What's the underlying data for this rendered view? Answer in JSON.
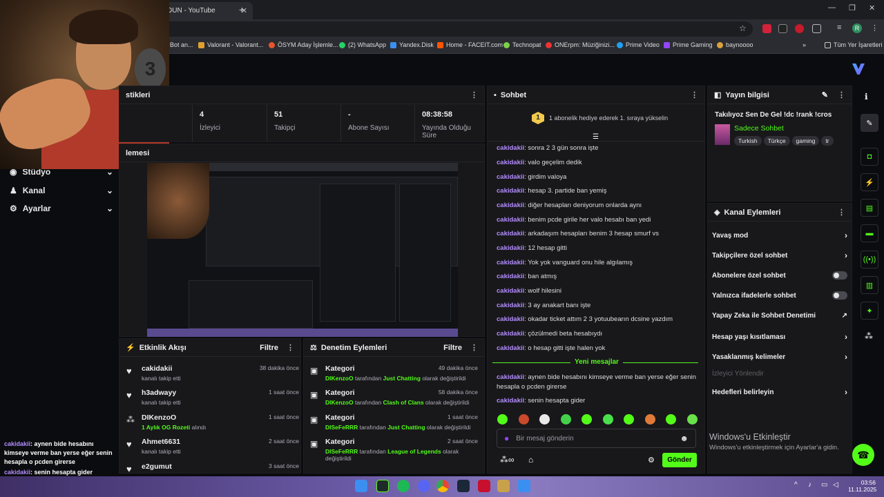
{
  "browser": {
    "tab_title": "DUN - YouTube",
    "bookmarks": [
      "Bot an...",
      "Valorant - Valorant...",
      "ÖSYM Aday İşlemle...",
      "(2) WhatsApp",
      "Yandex.Disk",
      "Home - FACEIT.com",
      "Technopat",
      "ONErpm: Müziğinizi...",
      "Prime Video",
      "Prime Gaming",
      "baynoooo"
    ],
    "all_bookmarks": "Tüm Yer İşaretleri",
    "profile_initial": "R"
  },
  "sidebar": {
    "items": [
      "Stüdyo",
      "Kanal",
      "Ayarlar"
    ]
  },
  "overlay_chat": [
    {
      "user": "cakidakii",
      "msg": "aynen bide hesabını kimseye verme ban yerse eğer senin hesapla o pcden girerse"
    },
    {
      "user": "cakidakii",
      "msg": "senin hesapta gider"
    }
  ],
  "stats_panel": {
    "title_partial": "stikleri",
    "stats": [
      {
        "value": "4",
        "label": "İzleyici"
      },
      {
        "value": "51",
        "label": "Takipçi"
      },
      {
        "value": "-",
        "label": "Abone Sayısı"
      },
      {
        "value": "08:38:58",
        "label": "Yayında Olduğu Süre"
      }
    ]
  },
  "preview": {
    "title_partial": "lemesi"
  },
  "activity": {
    "title": "Etkinlik Akışı",
    "filter": "Filtre",
    "items": [
      {
        "name": "cakidakii",
        "sub": "kanalı takip etti",
        "time": "38 dakika önce",
        "icon": "heart-icon"
      },
      {
        "name": "h3adwayy",
        "sub": "kanalı takip etti",
        "time": "1 saat önce",
        "icon": "heart-icon"
      },
      {
        "name": "DIKenzoO",
        "sub": "1 Aylık OG Rozeti",
        "sub2": " alındı",
        "time": "1 saat önce",
        "icon": "badge-icon"
      },
      {
        "name": "Ahmet6631",
        "sub": "kanalı takip etti",
        "time": "2 saat önce",
        "icon": "heart-icon"
      },
      {
        "name": "e2gumut",
        "sub": "",
        "time": "3 saat önce",
        "icon": "heart-icon"
      }
    ]
  },
  "moderation": {
    "title": "Denetim Eylemleri",
    "filter": "Filtre",
    "items": [
      {
        "title": "Kategori",
        "user": "DIKenzoO",
        "mid": " tarafından ",
        "cat": "Just Chatting",
        "end": " olarak değiştirildi",
        "time": "49 dakika önce"
      },
      {
        "title": "Kategori",
        "user": "DIKenzoO",
        "mid": " tarafından ",
        "cat": "Clash of Clans",
        "end": " olarak değiştirildi",
        "time": "58 dakika önce"
      },
      {
        "title": "Kategori",
        "user": "DISeFeRRR",
        "mid": " tarafından ",
        "cat": "Just Chatting",
        "end": " olarak değiştirildi",
        "time": "1 saat önce"
      },
      {
        "title": "Kategori",
        "user": "DISeFeRRR",
        "mid": " tarafından ",
        "cat": "League of Legends",
        "end": "  olarak değiştirildi",
        "time": "2 saat önce"
      }
    ]
  },
  "chat": {
    "title": "Sohbet",
    "promo": "1 abonelik hediye ederek 1. sıraya yükselin",
    "promo_rank": "1",
    "messages": [
      {
        "user": "cakidakii",
        "msg": "sonra 2 3 gün sonra işte"
      },
      {
        "user": "cakidakii",
        "msg": "valo geçelim dedik"
      },
      {
        "user": "cakidakii",
        "msg": "girdim valoya"
      },
      {
        "user": "cakidakii",
        "msg": "hesap 3. partide ban yemiş"
      },
      {
        "user": "cakidakii",
        "msg": "diğer hesapları deniyorum onlarda aynı"
      },
      {
        "user": "cakidakii",
        "msg": "benim pcde girile her valo hesabı ban yedi"
      },
      {
        "user": "cakidakii",
        "msg": "arkadaşım hesapları benim 3 hesap smurf vs"
      },
      {
        "user": "cakidakii",
        "msg": "12 hesap gitti"
      },
      {
        "user": "cakidakii",
        "msg": "Yok yok vanguard onu hile algılamış"
      },
      {
        "user": "cakidakii",
        "msg": "ban atmış"
      },
      {
        "user": "cakidakii",
        "msg": "wolf hilesini"
      },
      {
        "user": "cakidakii",
        "msg": "3 ay anakart banı işte"
      },
      {
        "user": "cakidakii",
        "msg": "okadar ticket attım 2 3 yotuubearın dcsine yazdım"
      },
      {
        "user": "cakidakii",
        "msg": "çözülmedi beta hesabıydı"
      },
      {
        "user": "cakidakii",
        "msg": "o hesap gitti işte halen yok"
      }
    ],
    "new_messages": "Yeni mesajlar",
    "new": [
      {
        "user": "cakidakii",
        "msg": "aynen bide hesabını kimseye verme ban yerse eğer senin hesapla o pcden girerse"
      },
      {
        "user": "cakidakii",
        "msg": "senin hesapta gider"
      }
    ],
    "placeholder": "Bir mesaj gönderin",
    "send": "Gönder"
  },
  "stream_info": {
    "title": "Yayın bilgisi",
    "stream_title": "Takılıyoz Sen De Gel !dc !rank !cros",
    "category": "Sadece Sohbet",
    "tags": [
      "Turkish",
      "Türkçe",
      "gaming",
      "tr"
    ]
  },
  "channel_actions": {
    "title": "Kanal Eylemleri",
    "items": [
      {
        "label": "Yavaş mod",
        "type": "chevron"
      },
      {
        "label": "Takipçilere özel sohbet",
        "type": "chevron"
      },
      {
        "label": "Abonelere özel sohbet",
        "type": "toggle"
      },
      {
        "label": "Yalnızca ifadelerle sohbet",
        "type": "toggle"
      },
      {
        "label": "Yapay Zeka ile Sohbet Denetimi",
        "type": "external"
      },
      {
        "label": "Hesap yaşı kısıtlaması",
        "type": "chevron"
      },
      {
        "label": "Yasaklanmış kelimeler",
        "type": "chevron"
      },
      {
        "label": "İzleyici Yönlendir",
        "type": "disabled"
      },
      {
        "label": "Hedefleri belirleyin",
        "type": "chevron"
      }
    ]
  },
  "windows": {
    "activate_title": "Windows'u Etkinleştir",
    "activate_sub": "Windows'u etkinleştirmek için Ayarlar'a gidin."
  },
  "taskbar": {
    "time": "03:56",
    "date": "11.11.2025"
  },
  "colors": {
    "accent": "#53fc18",
    "username": "#b38cff",
    "panel": "#18181b"
  }
}
